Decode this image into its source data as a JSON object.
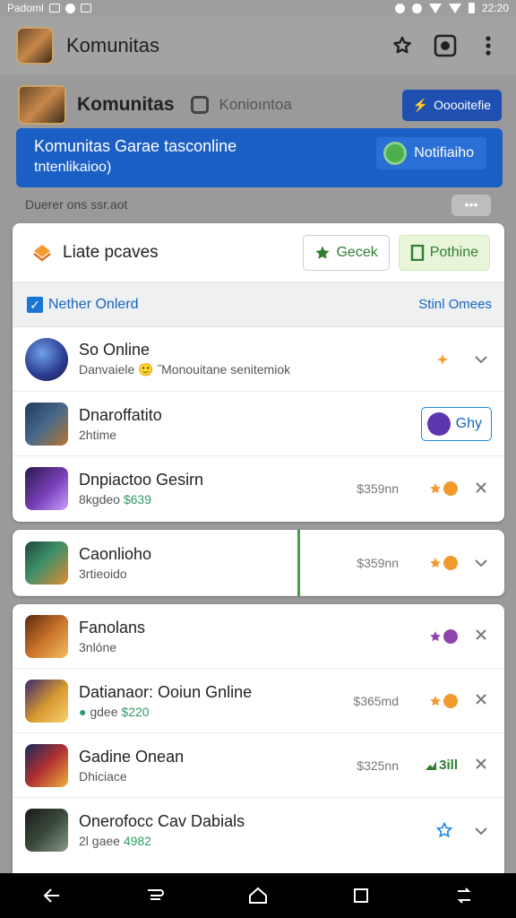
{
  "status_bar": {
    "left_text": "Padoml",
    "time": "22:20"
  },
  "app_bar": {
    "title": "Komunitas"
  },
  "background": {
    "community_name": "Komunitas",
    "community_sub": "Konioıntoa",
    "blue_button_label": "Ooooitefie",
    "banner_line1": "Komunitas Garae tasconline",
    "banner_line2": "tntenlikaioo)",
    "notify_button_label": "Notifiaiho",
    "caption": "Duerer ons ssr.aot",
    "more_label": "•••"
  },
  "card1": {
    "title": "Liate pcaves",
    "gecek_label": "Gecek",
    "pothine_label": "Pothine",
    "filter_label": "Nether Onlerd",
    "filter_link": "Stinl Omees",
    "rows": [
      {
        "name": "So Online",
        "sub": "Danvaiele 🙂 ˝Monouitane senitemiok",
        "rating": "",
        "amount": ""
      },
      {
        "name": "Dnaroffatito",
        "sub": "2htime",
        "play_label": "Ghy"
      },
      {
        "name": "Dnpiactoo Gesirn",
        "sub_prefix": "8kgdeo",
        "sub_price": "$639",
        "amount": "$359nn"
      }
    ]
  },
  "card2": {
    "rows": [
      {
        "name": "Caonlioho",
        "sub": "3rtieoido",
        "amount": "$359nn"
      }
    ]
  },
  "card3": {
    "rows": [
      {
        "name": "Fanolans",
        "sub": "3nlóne"
      },
      {
        "name": "Datianaor: Ooiun Gnline",
        "sub_prefix": "gdee",
        "sub_price": "$220",
        "amount": "$365md"
      },
      {
        "name": "Gadine Onean",
        "sub": "Dhiciace",
        "amount": "$325nn",
        "rating": "3ill"
      },
      {
        "name": "Onerofocc Cav Dabials",
        "sub_prefix": "2l gaee",
        "sub_price": "4982"
      }
    ]
  },
  "colors": {
    "accent_blue": "#1b5fc4",
    "green": "#2e7d32",
    "orange": "#f29a2e",
    "purple": "#8e44ad"
  }
}
